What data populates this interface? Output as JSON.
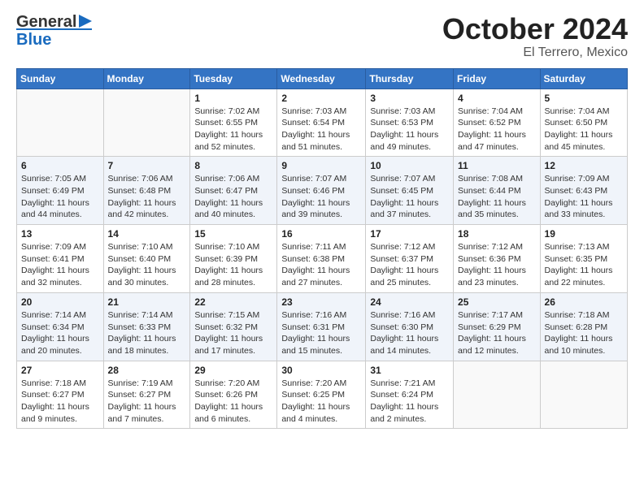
{
  "header": {
    "logo_general": "General",
    "logo_blue": "Blue",
    "month_title": "October 2024",
    "subtitle": "El Terrero, Mexico"
  },
  "calendar": {
    "days_of_week": [
      "Sunday",
      "Monday",
      "Tuesday",
      "Wednesday",
      "Thursday",
      "Friday",
      "Saturday"
    ],
    "weeks": [
      {
        "days": [
          {
            "number": "",
            "sunrise": "",
            "sunset": "",
            "daylight": "",
            "empty": true
          },
          {
            "number": "",
            "sunrise": "",
            "sunset": "",
            "daylight": "",
            "empty": true
          },
          {
            "number": "1",
            "sunrise": "Sunrise: 7:02 AM",
            "sunset": "Sunset: 6:55 PM",
            "daylight": "Daylight: 11 hours and 52 minutes.",
            "empty": false
          },
          {
            "number": "2",
            "sunrise": "Sunrise: 7:03 AM",
            "sunset": "Sunset: 6:54 PM",
            "daylight": "Daylight: 11 hours and 51 minutes.",
            "empty": false
          },
          {
            "number": "3",
            "sunrise": "Sunrise: 7:03 AM",
            "sunset": "Sunset: 6:53 PM",
            "daylight": "Daylight: 11 hours and 49 minutes.",
            "empty": false
          },
          {
            "number": "4",
            "sunrise": "Sunrise: 7:04 AM",
            "sunset": "Sunset: 6:52 PM",
            "daylight": "Daylight: 11 hours and 47 minutes.",
            "empty": false
          },
          {
            "number": "5",
            "sunrise": "Sunrise: 7:04 AM",
            "sunset": "Sunset: 6:50 PM",
            "daylight": "Daylight: 11 hours and 45 minutes.",
            "empty": false
          }
        ]
      },
      {
        "days": [
          {
            "number": "6",
            "sunrise": "Sunrise: 7:05 AM",
            "sunset": "Sunset: 6:49 PM",
            "daylight": "Daylight: 11 hours and 44 minutes.",
            "empty": false
          },
          {
            "number": "7",
            "sunrise": "Sunrise: 7:06 AM",
            "sunset": "Sunset: 6:48 PM",
            "daylight": "Daylight: 11 hours and 42 minutes.",
            "empty": false
          },
          {
            "number": "8",
            "sunrise": "Sunrise: 7:06 AM",
            "sunset": "Sunset: 6:47 PM",
            "daylight": "Daylight: 11 hours and 40 minutes.",
            "empty": false
          },
          {
            "number": "9",
            "sunrise": "Sunrise: 7:07 AM",
            "sunset": "Sunset: 6:46 PM",
            "daylight": "Daylight: 11 hours and 39 minutes.",
            "empty": false
          },
          {
            "number": "10",
            "sunrise": "Sunrise: 7:07 AM",
            "sunset": "Sunset: 6:45 PM",
            "daylight": "Daylight: 11 hours and 37 minutes.",
            "empty": false
          },
          {
            "number": "11",
            "sunrise": "Sunrise: 7:08 AM",
            "sunset": "Sunset: 6:44 PM",
            "daylight": "Daylight: 11 hours and 35 minutes.",
            "empty": false
          },
          {
            "number": "12",
            "sunrise": "Sunrise: 7:09 AM",
            "sunset": "Sunset: 6:43 PM",
            "daylight": "Daylight: 11 hours and 33 minutes.",
            "empty": false
          }
        ]
      },
      {
        "days": [
          {
            "number": "13",
            "sunrise": "Sunrise: 7:09 AM",
            "sunset": "Sunset: 6:41 PM",
            "daylight": "Daylight: 11 hours and 32 minutes.",
            "empty": false
          },
          {
            "number": "14",
            "sunrise": "Sunrise: 7:10 AM",
            "sunset": "Sunset: 6:40 PM",
            "daylight": "Daylight: 11 hours and 30 minutes.",
            "empty": false
          },
          {
            "number": "15",
            "sunrise": "Sunrise: 7:10 AM",
            "sunset": "Sunset: 6:39 PM",
            "daylight": "Daylight: 11 hours and 28 minutes.",
            "empty": false
          },
          {
            "number": "16",
            "sunrise": "Sunrise: 7:11 AM",
            "sunset": "Sunset: 6:38 PM",
            "daylight": "Daylight: 11 hours and 27 minutes.",
            "empty": false
          },
          {
            "number": "17",
            "sunrise": "Sunrise: 7:12 AM",
            "sunset": "Sunset: 6:37 PM",
            "daylight": "Daylight: 11 hours and 25 minutes.",
            "empty": false
          },
          {
            "number": "18",
            "sunrise": "Sunrise: 7:12 AM",
            "sunset": "Sunset: 6:36 PM",
            "daylight": "Daylight: 11 hours and 23 minutes.",
            "empty": false
          },
          {
            "number": "19",
            "sunrise": "Sunrise: 7:13 AM",
            "sunset": "Sunset: 6:35 PM",
            "daylight": "Daylight: 11 hours and 22 minutes.",
            "empty": false
          }
        ]
      },
      {
        "days": [
          {
            "number": "20",
            "sunrise": "Sunrise: 7:14 AM",
            "sunset": "Sunset: 6:34 PM",
            "daylight": "Daylight: 11 hours and 20 minutes.",
            "empty": false
          },
          {
            "number": "21",
            "sunrise": "Sunrise: 7:14 AM",
            "sunset": "Sunset: 6:33 PM",
            "daylight": "Daylight: 11 hours and 18 minutes.",
            "empty": false
          },
          {
            "number": "22",
            "sunrise": "Sunrise: 7:15 AM",
            "sunset": "Sunset: 6:32 PM",
            "daylight": "Daylight: 11 hours and 17 minutes.",
            "empty": false
          },
          {
            "number": "23",
            "sunrise": "Sunrise: 7:16 AM",
            "sunset": "Sunset: 6:31 PM",
            "daylight": "Daylight: 11 hours and 15 minutes.",
            "empty": false
          },
          {
            "number": "24",
            "sunrise": "Sunrise: 7:16 AM",
            "sunset": "Sunset: 6:30 PM",
            "daylight": "Daylight: 11 hours and 14 minutes.",
            "empty": false
          },
          {
            "number": "25",
            "sunrise": "Sunrise: 7:17 AM",
            "sunset": "Sunset: 6:29 PM",
            "daylight": "Daylight: 11 hours and 12 minutes.",
            "empty": false
          },
          {
            "number": "26",
            "sunrise": "Sunrise: 7:18 AM",
            "sunset": "Sunset: 6:28 PM",
            "daylight": "Daylight: 11 hours and 10 minutes.",
            "empty": false
          }
        ]
      },
      {
        "days": [
          {
            "number": "27",
            "sunrise": "Sunrise: 7:18 AM",
            "sunset": "Sunset: 6:27 PM",
            "daylight": "Daylight: 11 hours and 9 minutes.",
            "empty": false
          },
          {
            "number": "28",
            "sunrise": "Sunrise: 7:19 AM",
            "sunset": "Sunset: 6:27 PM",
            "daylight": "Daylight: 11 hours and 7 minutes.",
            "empty": false
          },
          {
            "number": "29",
            "sunrise": "Sunrise: 7:20 AM",
            "sunset": "Sunset: 6:26 PM",
            "daylight": "Daylight: 11 hours and 6 minutes.",
            "empty": false
          },
          {
            "number": "30",
            "sunrise": "Sunrise: 7:20 AM",
            "sunset": "Sunset: 6:25 PM",
            "daylight": "Daylight: 11 hours and 4 minutes.",
            "empty": false
          },
          {
            "number": "31",
            "sunrise": "Sunrise: 7:21 AM",
            "sunset": "Sunset: 6:24 PM",
            "daylight": "Daylight: 11 hours and 2 minutes.",
            "empty": false
          },
          {
            "number": "",
            "sunrise": "",
            "sunset": "",
            "daylight": "",
            "empty": true
          },
          {
            "number": "",
            "sunrise": "",
            "sunset": "",
            "daylight": "",
            "empty": true
          }
        ]
      }
    ]
  }
}
